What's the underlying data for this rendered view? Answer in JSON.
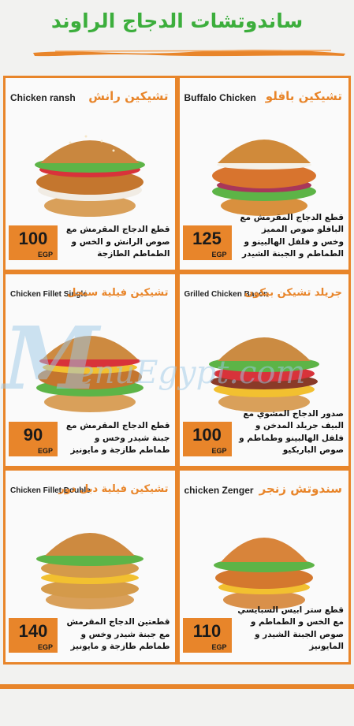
{
  "header": {
    "title": "ساندوتشات الدجاج الراوند"
  },
  "watermark": {
    "initial": "M",
    "text": "enuEgypt.com"
  },
  "items": [
    {
      "en": "Chicken ransh",
      "ar": "تشيكين رانش",
      "price": "100",
      "currency": "EGP",
      "desc": "قطع الدجاج المقرمش مع صوص الرانش و الخس و الطماطم الطازجة"
    },
    {
      "en": "Buffalo Chicken",
      "ar": "تشيكين بافلو",
      "price": "125",
      "currency": "EGP",
      "desc": "قطع الدجاج المقرمش مع البافلو صوص المميز وخس و فلفل الهالبينو و الطماطم و الجبنة الشيدر"
    },
    {
      "en": "Chicken Fillet Single",
      "ar": "تشيكين فيلية سنجل",
      "price": "90",
      "currency": "EGP",
      "desc": "قطع الدجاج المقرمش مع جبنة شيدر وخس و طماطم طازجة و مايونيز"
    },
    {
      "en": "Grilled Chicken Bacon",
      "ar": "جريلد تشيكن بيكون",
      "price": "100",
      "currency": "EGP",
      "desc": "صدور الدجاج المشوي مع البيف جريلد المدخن و فلفل الهالبينو وطماطم و صوص الباربكيو"
    },
    {
      "en": "Chicken Fillet Double",
      "ar": "تشيكين فيلية دبل دور",
      "price": "140",
      "currency": "EGP",
      "desc": "قطعتين الدجاج المقرمش مع جبنة شيدر وخس و طماطم طازجة و مايونيز"
    },
    {
      "en": "chicken Zenger",
      "ar": "سندوتش زنجر",
      "price": "110",
      "currency": "EGP",
      "desc": "قطع ستر ابيس السبايسي مع الخس و الطماطم و صوص الجبنة الشيدر و المايونيز"
    }
  ]
}
